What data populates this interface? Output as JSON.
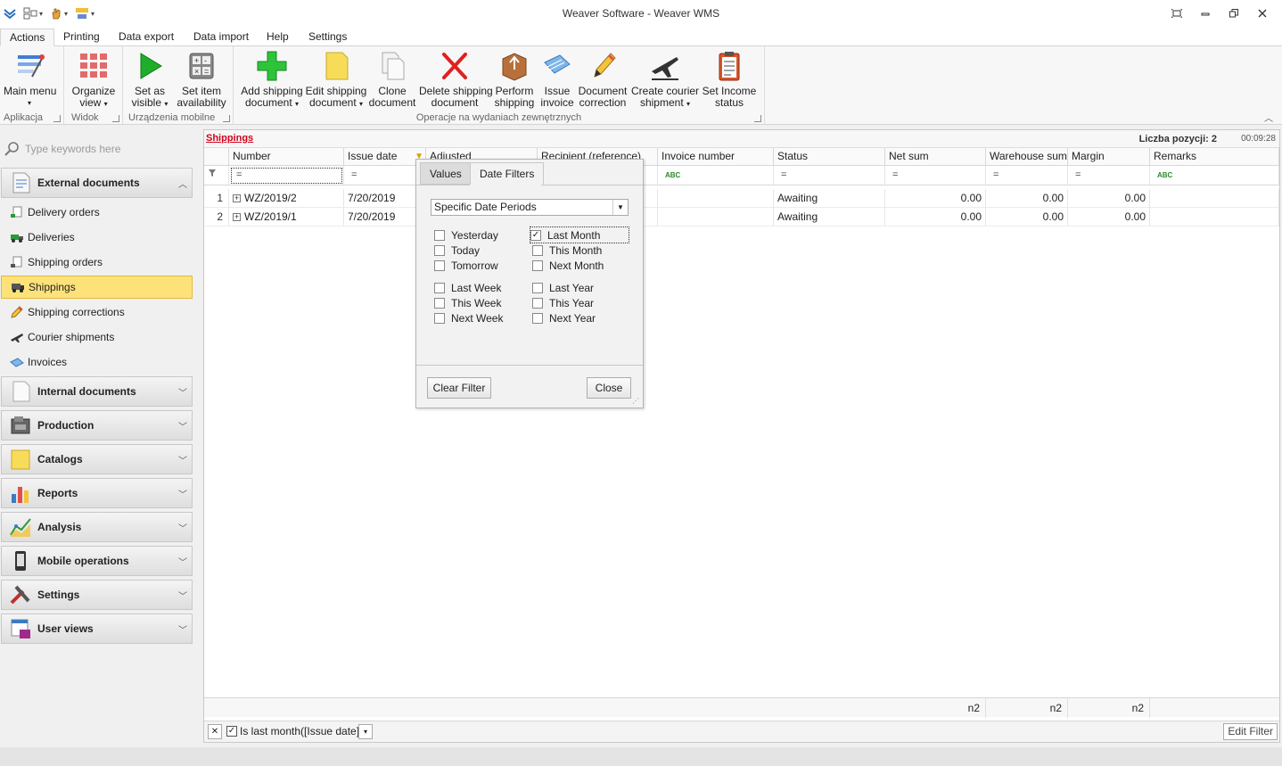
{
  "window": {
    "title": "Weaver Software - Weaver WMS"
  },
  "ribbon_tabs": [
    {
      "label": "Actions",
      "active": true
    },
    {
      "label": "Printing"
    },
    {
      "label": "Data export"
    },
    {
      "label": "Data import"
    },
    {
      "label": "Help"
    },
    {
      "label": "Settings"
    }
  ],
  "ribbon": {
    "groups": [
      {
        "label": "Aplikacja"
      },
      {
        "label": "Widok"
      },
      {
        "label": "Urządzenia mobilne"
      },
      {
        "label": "Operacje na wydaniach zewnętrznych"
      }
    ],
    "buttons": {
      "main_menu": {
        "line1": "Main menu",
        "line2": ""
      },
      "organize_view": {
        "line1": "Organize",
        "line2": "view"
      },
      "set_visible": {
        "line1": "Set as",
        "line2": "visible"
      },
      "set_availability": {
        "line1": "Set item",
        "line2": "availability"
      },
      "add_shipping": {
        "line1": "Add shipping",
        "line2": "document"
      },
      "edit_shipping": {
        "line1": "Edit shipping",
        "line2": "document"
      },
      "clone": {
        "line1": "Clone",
        "line2": "document"
      },
      "delete_shipping": {
        "line1": "Delete shipping",
        "line2": "document"
      },
      "perform_shipping": {
        "line1": "Perform",
        "line2": "shipping"
      },
      "issue_invoice": {
        "line1": "Issue",
        "line2": "invoice"
      },
      "doc_correction": {
        "line1": "Document",
        "line2": "correction"
      },
      "courier_shipment": {
        "line1": "Create courier",
        "line2": "shipment"
      },
      "income_status": {
        "line1": "Set Income",
        "line2": "status"
      }
    },
    "dropdown_glyph": "▾"
  },
  "sidebar": {
    "search_placeholder": "Type keywords here",
    "groups": [
      {
        "label": "External documents",
        "expanded": true
      },
      {
        "label": "Internal documents"
      },
      {
        "label": "Production"
      },
      {
        "label": "Catalogs"
      },
      {
        "label": "Reports"
      },
      {
        "label": "Analysis"
      },
      {
        "label": "Mobile operations"
      },
      {
        "label": "Settings"
      },
      {
        "label": "User views"
      }
    ],
    "items": [
      {
        "label": "Delivery orders"
      },
      {
        "label": "Deliveries"
      },
      {
        "label": "Shipping orders"
      },
      {
        "label": "Shippings",
        "active": true
      },
      {
        "label": "Shipping corrections"
      },
      {
        "label": "Courier shipments"
      },
      {
        "label": "Invoices"
      }
    ]
  },
  "grid": {
    "breadcrumb": "Shippings",
    "count": "Liczba pozycji: 2",
    "timer": "00:09:28",
    "columns": [
      "Number",
      "Issue date",
      "Adjusted",
      "Recipient (reference)",
      "Invoice number",
      "Status",
      "Net sum",
      "Warehouse sum",
      "Margin",
      "Remarks"
    ],
    "filter_equals": "=",
    "filter_abc": "ABC",
    "rows": [
      {
        "n": "1",
        "number": "WZ/2019/2",
        "issue_date": "7/20/2019",
        "status": "Awaiting",
        "net": "0.00",
        "warehouse": "0.00",
        "margin": "0.00"
      },
      {
        "n": "2",
        "number": "WZ/2019/1",
        "issue_date": "7/20/2019",
        "status": "Awaiting",
        "net": "0.00",
        "warehouse": "0.00",
        "margin": "0.00"
      }
    ],
    "footer": {
      "net": "n2",
      "warehouse": "n2",
      "margin": "n2"
    },
    "filter_bar": {
      "text": "Is last month([Issue date])",
      "edit": "Edit Filter",
      "checked": true
    }
  },
  "date_filter_popup": {
    "tabs": [
      "Values",
      "Date Filters"
    ],
    "active_tab": "Date Filters",
    "period_select": "Specific Date Periods",
    "options_left": [
      "Yesterday",
      "Today",
      "Tomorrow",
      "Last Week",
      "This Week",
      "Next Week"
    ],
    "options_right": [
      "Last Month",
      "This Month",
      "Next Month",
      "Last Year",
      "This Year",
      "Next Year"
    ],
    "checked": "Last Month",
    "clear_button": "Clear Filter",
    "close_button": "Close"
  }
}
